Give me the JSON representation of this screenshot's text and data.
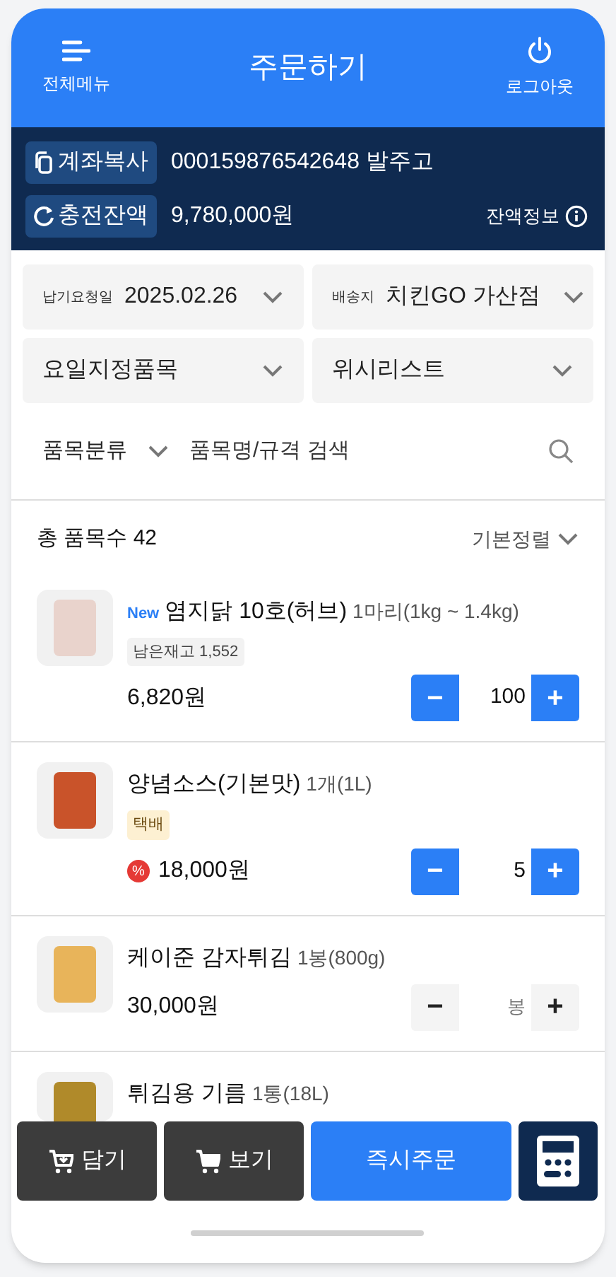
{
  "header": {
    "menu_label": "전체메뉴",
    "title": "주문하기",
    "logout_label": "로그아웃"
  },
  "account": {
    "copy_button": "계좌복사",
    "account_text": "000159876542648 발주고",
    "refresh_button": "충전잔액",
    "balance": "9,780,000원",
    "balance_info": "잔액정보"
  },
  "filters": [
    {
      "label": "납기요청일",
      "value": "2025.02.26"
    },
    {
      "label": "배송지",
      "value": "치킨GO 가산점"
    },
    {
      "value": "요일지정품목"
    },
    {
      "value": "위시리스트"
    }
  ],
  "search": {
    "category": "품목분류",
    "placeholder": "품목명/규격 검색"
  },
  "list_header": {
    "total": "총 품목수 42",
    "sort": "기본정렬"
  },
  "products": [
    {
      "name": "염지닭 10호(허브)",
      "spec": "1마리(1kg ~ 1.4kg)",
      "new_label": "New",
      "tags": [
        {
          "kind": "stock",
          "text": "남은재고 1,552"
        }
      ],
      "price": "6,820원",
      "in_cart": true,
      "decrease": "−",
      "quantity": "100",
      "increase": "+"
    },
    {
      "name": "양념소스(기본맛)",
      "spec": "1개(1L)",
      "tags": [
        {
          "kind": "delivery",
          "text": "택배"
        }
      ],
      "discount": "%",
      "price": "18,000원",
      "in_cart": true,
      "decrease": "−",
      "quantity": "5",
      "increase": "+"
    },
    {
      "name": "케이준 감자튀김",
      "spec": "1봉(800g)",
      "price": "30,000원",
      "in_cart": false,
      "decrease": "−",
      "placeholder": "봉",
      "increase": "+"
    },
    {
      "name": "튀김용 기름",
      "spec": "1통(18L)"
    }
  ],
  "bottom_bar": {
    "add_button": "담기",
    "view_button": "보기",
    "order_button": "즉시주문"
  }
}
